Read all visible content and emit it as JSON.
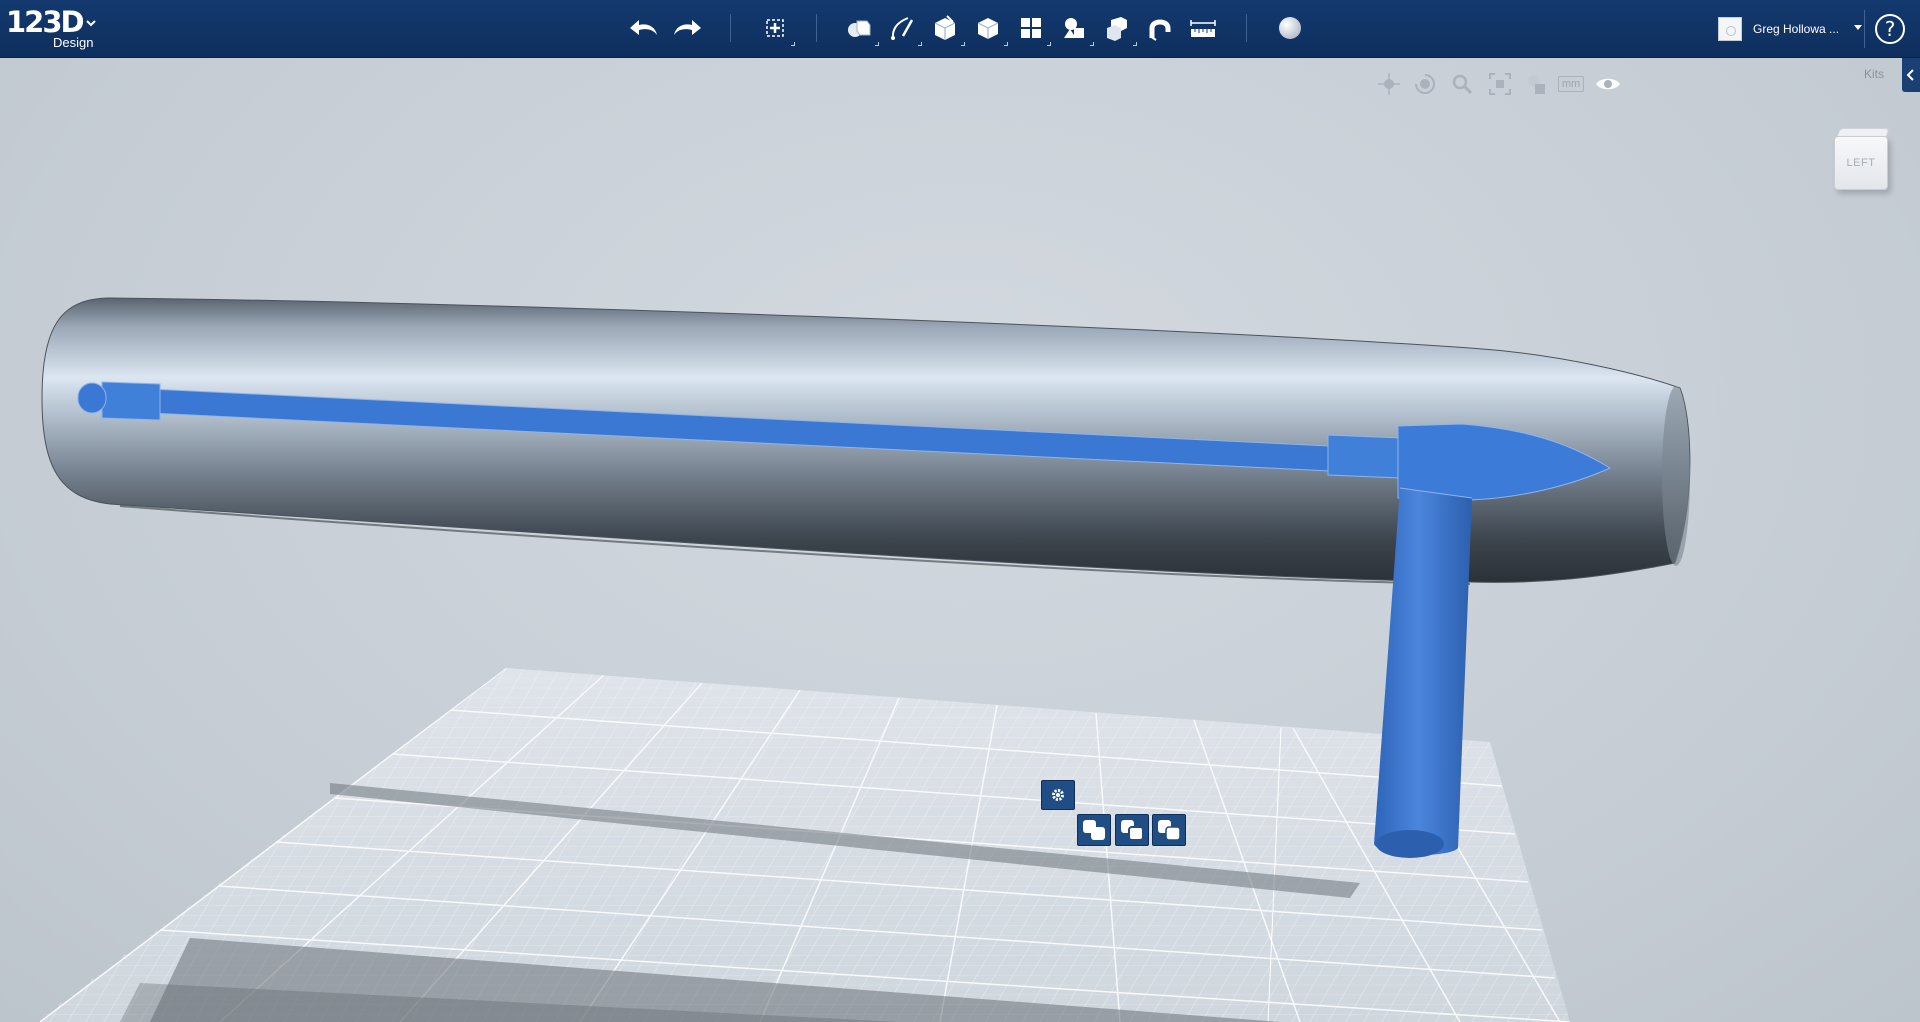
{
  "app": {
    "logo_main": "123D",
    "logo_sub": "Design"
  },
  "toolbar": {
    "undo_icon": "undo-icon",
    "redo_icon": "redo-icon",
    "transform_icon": "transform-icon",
    "primitives_icon": "primitives-icon",
    "sketch_icon": "sketch-icon",
    "construct_icon": "construct-icon",
    "modify_icon": "modify-icon",
    "pattern_icon": "pattern-icon",
    "grouping_icon": "grouping-icon",
    "combine_icon": "combine-icon",
    "snap_icon": "snap-icon",
    "measure_icon": "measure-icon",
    "material_icon": "material-icon"
  },
  "user": {
    "name": "Greg Hollowa ..."
  },
  "help": {
    "label": "?"
  },
  "navbar": {
    "unit_label": "mm"
  },
  "kits": {
    "label": "Kits"
  },
  "viewcube": {
    "face_label": "LEFT"
  },
  "colors": {
    "topbar": "#13396e",
    "viewport_bg": "#c9d0d8",
    "selection_blue": "#3a78d4",
    "object_gray": "#8f9aa6",
    "button_blue": "#1f4d84"
  }
}
